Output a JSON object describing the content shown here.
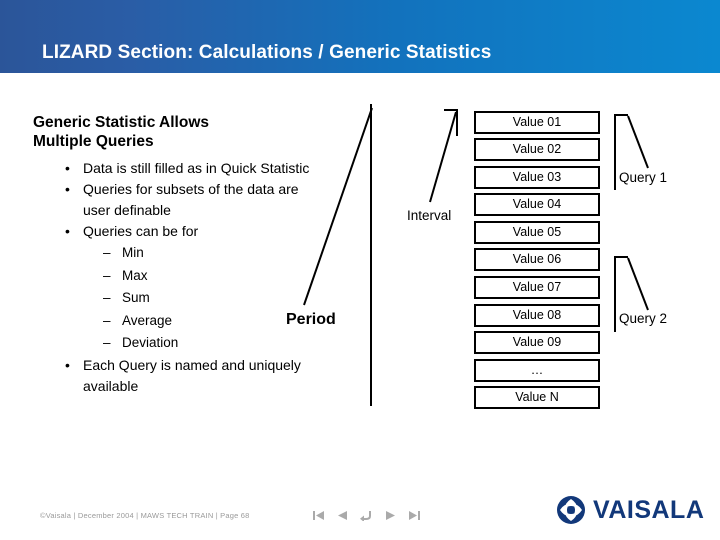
{
  "slide": {
    "title": "LIZARD Section: Calculations / Generic Statistics"
  },
  "content": {
    "heading_line1": "Generic Statistic Allows",
    "heading_line2": "Multiple Queries",
    "bullet_marker": "•",
    "sub_bullet_marker": "–",
    "bullets": [
      {
        "text": "Data is still filled as in Quick Statistic"
      },
      {
        "text": "Queries for subsets of the data are user definable"
      },
      {
        "text": "Queries can be for"
      },
      {
        "text": "Each Query is named and uniquely available"
      }
    ],
    "sub_bullets": [
      {
        "text": "Min"
      },
      {
        "text": "Max"
      },
      {
        "text": "Sum"
      },
      {
        "text": "Average"
      },
      {
        "text": "Deviation"
      }
    ]
  },
  "diagram": {
    "value_boxes": [
      {
        "label": "Value 01"
      },
      {
        "label": "Value 02"
      },
      {
        "label": "Value 03"
      },
      {
        "label": "Value 04"
      },
      {
        "label": "Value 05"
      },
      {
        "label": "Value 06"
      },
      {
        "label": "Value 07"
      },
      {
        "label": "Value 08"
      },
      {
        "label": "Value 09"
      },
      {
        "label": "…"
      },
      {
        "label": "Value N"
      }
    ],
    "interval_label": "Interval",
    "period_label": "Period",
    "query1_label": "Query 1",
    "query2_label": "Query 2",
    "line_color": "#000000"
  },
  "footer": {
    "credit": "©Vaisala | December 2004 | MAWS TECH TRAIN | Page 68",
    "nav_buttons": [
      {
        "name": "first-slide-button",
        "icon": "skip-back-icon"
      },
      {
        "name": "previous-slide-button",
        "icon": "play-back-icon"
      },
      {
        "name": "return-button",
        "icon": "return-arrow-icon"
      },
      {
        "name": "next-slide-button",
        "icon": "play-forward-icon"
      },
      {
        "name": "last-slide-button",
        "icon": "skip-forward-icon"
      }
    ],
    "nav_color": "#aaaaaa"
  },
  "logo": {
    "wordmark": "VAISALA",
    "color": "#12387a"
  }
}
